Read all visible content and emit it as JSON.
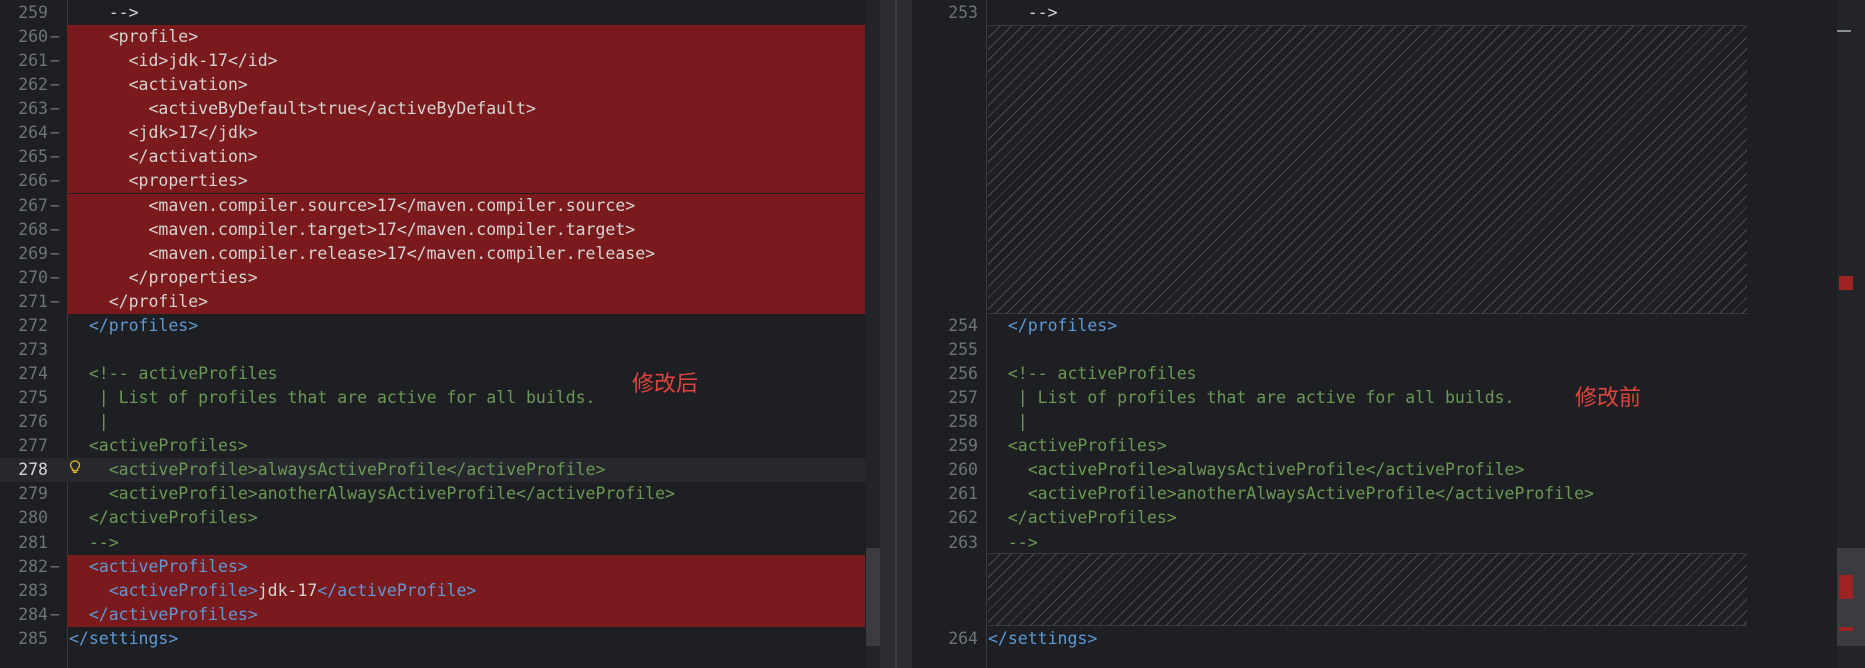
{
  "left": {
    "annotation": "修改后",
    "lines": [
      {
        "n": "259",
        "fold": "",
        "deleted": false,
        "segs": [
          [
            "txt",
            "    -->"
          ]
        ]
      },
      {
        "n": "260",
        "fold": "−",
        "deleted": true,
        "segs": [
          [
            "txt",
            "    <profile>"
          ]
        ]
      },
      {
        "n": "261",
        "fold": "−",
        "deleted": true,
        "segs": [
          [
            "txt",
            "      <id>jdk-17</id>"
          ]
        ]
      },
      {
        "n": "262",
        "fold": "−",
        "deleted": true,
        "segs": [
          [
            "txt",
            "      <activation>"
          ]
        ]
      },
      {
        "n": "263",
        "fold": "−",
        "deleted": true,
        "segs": [
          [
            "txt",
            "        <activeByDefault>true</activeByDefault>"
          ]
        ]
      },
      {
        "n": "264",
        "fold": "−",
        "deleted": true,
        "segs": [
          [
            "txt",
            "      <jdk>17</jdk>"
          ]
        ]
      },
      {
        "n": "265",
        "fold": "−",
        "deleted": true,
        "segs": [
          [
            "txt",
            "      </activation>"
          ]
        ]
      },
      {
        "n": "266",
        "fold": "−",
        "deleted": true,
        "segs": [
          [
            "txt",
            "      <properties>"
          ]
        ]
      },
      {
        "n": "267",
        "fold": "−",
        "deleted": true,
        "segs": [
          [
            "txt",
            "        <maven.compiler.source>17</maven.compiler.source>"
          ]
        ]
      },
      {
        "n": "268",
        "fold": "−",
        "deleted": true,
        "segs": [
          [
            "txt",
            "        <maven.compiler.target>17</maven.compiler.target>"
          ]
        ]
      },
      {
        "n": "269",
        "fold": "−",
        "deleted": true,
        "segs": [
          [
            "txt",
            "        <maven.compiler.release>17</maven.compiler.release>"
          ]
        ]
      },
      {
        "n": "270",
        "fold": "−",
        "deleted": true,
        "segs": [
          [
            "txt",
            "      </properties>"
          ]
        ]
      },
      {
        "n": "271",
        "fold": "−",
        "deleted": true,
        "segs": [
          [
            "txt",
            "    </profile>"
          ]
        ]
      },
      {
        "n": "272",
        "fold": "",
        "deleted": false,
        "segs": [
          [
            "t",
            "  </"
          ],
          [
            "tb",
            "profiles"
          ],
          [
            "t",
            ">"
          ]
        ]
      },
      {
        "n": "273",
        "fold": "",
        "deleted": false,
        "segs": [
          [
            "txt",
            ""
          ]
        ]
      },
      {
        "n": "274",
        "fold": "",
        "deleted": false,
        "segs": [
          [
            "c",
            "  <!-- activeProfiles"
          ]
        ]
      },
      {
        "n": "275",
        "fold": "",
        "deleted": false,
        "segs": [
          [
            "c",
            "   | List of profiles that are active for all builds."
          ]
        ]
      },
      {
        "n": "276",
        "fold": "",
        "deleted": false,
        "segs": [
          [
            "c",
            "   |"
          ]
        ]
      },
      {
        "n": "277",
        "fold": "",
        "deleted": false,
        "segs": [
          [
            "c",
            "  <activeProfiles>"
          ]
        ]
      },
      {
        "n": "278",
        "fold": "",
        "deleted": false,
        "active": true,
        "segs": [
          [
            "c",
            "    <activeProfile>alwaysActiveProfile</activeProfile>"
          ]
        ]
      },
      {
        "n": "279",
        "fold": "",
        "deleted": false,
        "segs": [
          [
            "c",
            "    <activeProfile>anotherAlwaysActiveProfile</activeProfile>"
          ]
        ]
      },
      {
        "n": "280",
        "fold": "",
        "deleted": false,
        "segs": [
          [
            "c",
            "  </activeProfiles>"
          ]
        ]
      },
      {
        "n": "281",
        "fold": "",
        "deleted": false,
        "segs": [
          [
            "c",
            "  -->"
          ]
        ]
      },
      {
        "n": "282",
        "fold": "−",
        "deleted": true,
        "segs": [
          [
            "t",
            "  <"
          ],
          [
            "tb",
            "activeProfiles"
          ],
          [
            "t",
            ">"
          ]
        ]
      },
      {
        "n": "283",
        "fold": "",
        "deleted": true,
        "segs": [
          [
            "t",
            "    <"
          ],
          [
            "tb",
            "activeProfile"
          ],
          [
            "t",
            ">"
          ],
          [
            "txt",
            "jdk-17"
          ],
          [
            "t",
            "</"
          ],
          [
            "tb",
            "activeProfile"
          ],
          [
            "t",
            ">"
          ]
        ]
      },
      {
        "n": "284",
        "fold": "−",
        "deleted": true,
        "segs": [
          [
            "t",
            "  </"
          ],
          [
            "tb",
            "activeProfiles"
          ],
          [
            "t",
            ">"
          ]
        ]
      },
      {
        "n": "285",
        "fold": "",
        "deleted": false,
        "segs": [
          [
            "t",
            "</"
          ],
          [
            "tb",
            "settings"
          ],
          [
            "t",
            ">"
          ]
        ]
      }
    ]
  },
  "right": {
    "annotation": "修改前",
    "lines": [
      {
        "n": "253",
        "row": 0,
        "segs": [
          [
            "txt",
            "    -->"
          ]
        ]
      },
      {
        "n": "254",
        "row": 13,
        "segs": [
          [
            "t",
            "  </"
          ],
          [
            "tb",
            "profiles"
          ],
          [
            "t",
            ">"
          ]
        ]
      },
      {
        "n": "255",
        "row": 14,
        "segs": [
          [
            "txt",
            ""
          ]
        ]
      },
      {
        "n": "256",
        "row": 15,
        "segs": [
          [
            "c",
            "  <!-- activeProfiles"
          ]
        ]
      },
      {
        "n": "257",
        "row": 16,
        "segs": [
          [
            "c",
            "   | List of profiles that are active for all builds."
          ]
        ]
      },
      {
        "n": "258",
        "row": 17,
        "segs": [
          [
            "c",
            "   |"
          ]
        ]
      },
      {
        "n": "259",
        "row": 18,
        "segs": [
          [
            "c",
            "  <activeProfiles>"
          ]
        ]
      },
      {
        "n": "260",
        "row": 19,
        "segs": [
          [
            "c",
            "    <activeProfile>alwaysActiveProfile</activeProfile>"
          ]
        ]
      },
      {
        "n": "261",
        "row": 20,
        "segs": [
          [
            "c",
            "    <activeProfile>anotherAlwaysActiveProfile</activeProfile>"
          ]
        ]
      },
      {
        "n": "262",
        "row": 21,
        "segs": [
          [
            "c",
            "  </activeProfiles>"
          ]
        ]
      },
      {
        "n": "263",
        "row": 22,
        "segs": [
          [
            "c",
            "  -->"
          ]
        ]
      },
      {
        "n": "264",
        "row": 26,
        "segs": [
          [
            "t",
            "</"
          ],
          [
            "tb",
            "settings"
          ],
          [
            "t",
            ">"
          ]
        ]
      }
    ]
  },
  "colors": {
    "background": "#1e1f22",
    "deleted": "#7a1a1c",
    "tag": "#5c9ad6",
    "comment": "#6a9955",
    "text": "#d4d4d4",
    "annotation": "#e0443e"
  }
}
